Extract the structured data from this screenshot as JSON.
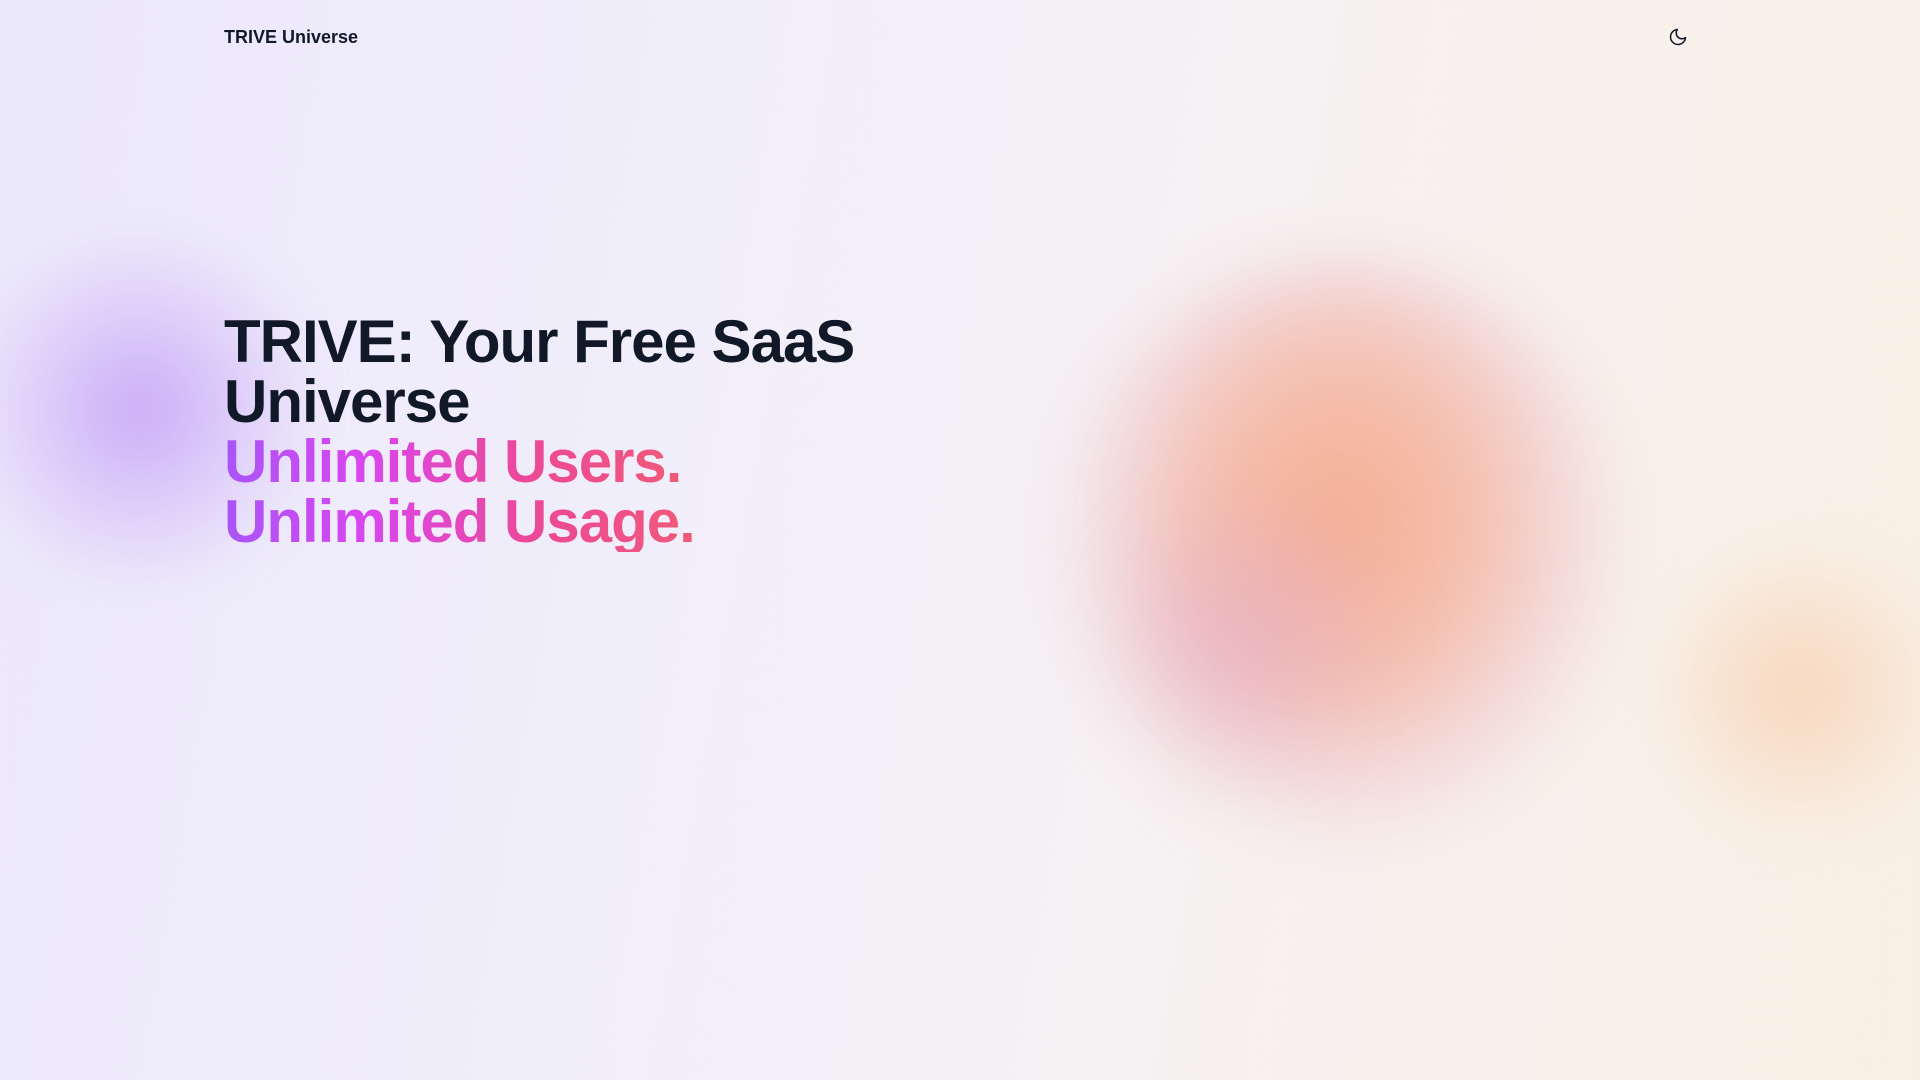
{
  "header": {
    "logo_text": "TRIVE Universe",
    "theme_toggle_icon": "moon-icon"
  },
  "hero": {
    "title_line1": "TRIVE: Your Free SaaS",
    "title_line2": "Universe",
    "tagline_line1": "Unlimited Users.",
    "tagline_line2": "Unlimited Usage."
  },
  "colors": {
    "text_dark": "#111827",
    "gradient_start": "#a855f7",
    "gradient_mid": "#ec4899",
    "gradient_end": "#f05a78"
  }
}
